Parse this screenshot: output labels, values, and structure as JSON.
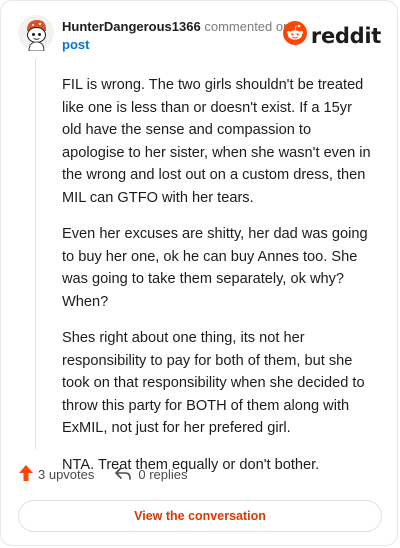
{
  "header": {
    "username": "HunterDangerous1366",
    "action": "commented on",
    "post_link": "post",
    "brand": "reddit"
  },
  "comment": {
    "paragraphs": [
      "FIL is wrong. The two girls shouldn't be treated like one is less than or doesn't exist. If a 15yr old have the sense and compassion to apologise to her sister, when she wasn't even in the wrong and lost out on a custom dress, then MIL can GTFO with her tears.",
      "Even her excuses are shitty, her dad was going to buy her one, ok he can buy Annes too. She was going to take them separately, ok why? When?",
      "Shes right about one thing, its not her responsibility to pay for both of them, but she took on that responsibility when she decided to throw this party for BOTH of them along with ExMIL, not just for her prefered girl.",
      "NTA. Treat them equally or don't bother."
    ]
  },
  "footer": {
    "upvotes": "3 upvotes",
    "replies": "0 replies"
  },
  "view_button": "View the conversation",
  "colors": {
    "brand_orange": "#ff4500",
    "link_blue": "#0079d3",
    "button_text": "#d93a00"
  },
  "icons": [
    "avatar-snoo",
    "reddit-logo-icon",
    "upvote-arrow-icon",
    "reply-arrow-icon"
  ]
}
